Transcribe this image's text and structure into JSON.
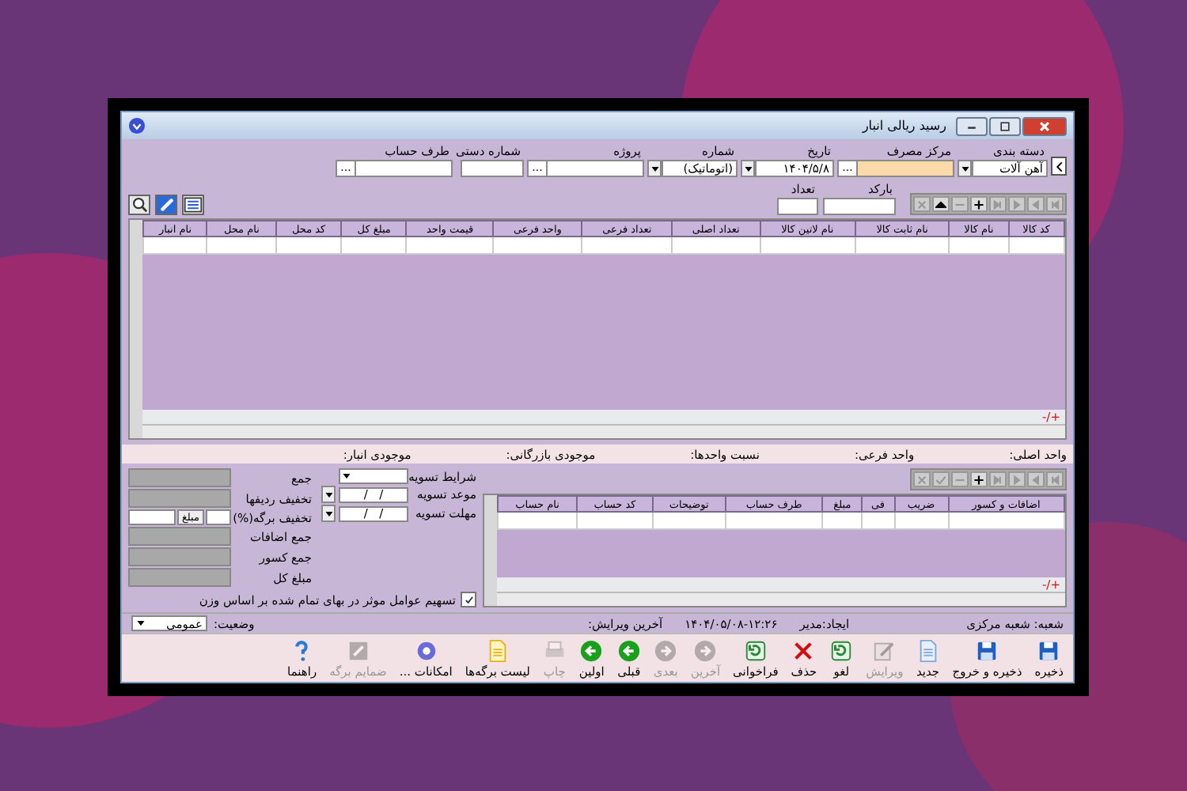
{
  "window": {
    "title": "رسید ریالی انبار"
  },
  "header_fields": [
    {
      "label": "دسته بندی",
      "kind": "dropdown",
      "value": "آهن آلات",
      "highlighted": false
    },
    {
      "label": "مرکز مصرف",
      "kind": "lookup",
      "lookup_button": "...",
      "highlighted": true
    },
    {
      "label": "تاریخ",
      "kind": "date",
      "value": "۱۴۰۴/۵/۸",
      "highlighted": false
    },
    {
      "label": "شماره",
      "kind": "dropdown",
      "value": "(اتوماتیک)",
      "highlighted": false
    },
    {
      "label": "پروژه",
      "kind": "lookup",
      "lookup_button": "...",
      "highlighted": false
    },
    {
      "label": "شماره دستی",
      "kind": "text",
      "highlighted": false
    },
    {
      "label": "طرف حساب",
      "kind": "lookup",
      "lookup_button": "...",
      "highlighted": false
    }
  ],
  "item_nav": [
    {
      "kind": "first",
      "disabled": true
    },
    {
      "kind": "prev",
      "disabled": true
    },
    {
      "kind": "next",
      "disabled": true
    },
    {
      "kind": "last",
      "disabled": true
    },
    {
      "kind": "add",
      "disabled": false
    },
    {
      "kind": "remove",
      "disabled": true
    },
    {
      "kind": "up",
      "disabled": false
    },
    {
      "kind": "cancel",
      "disabled": true
    }
  ],
  "barcode": {
    "label": "بارکد"
  },
  "quantity": {
    "label": "تعداد"
  },
  "items_table": {
    "columns": [
      "کد کالا",
      "نام کالا",
      "نام ثابت کالا",
      "نام لاتین کالا",
      "تعداد اصلی",
      "تعداد فرعی",
      "واحد فرعی",
      "قیمت واحد",
      "مبلغ کل",
      "کد محل",
      "نام محل",
      "نام انبار"
    ],
    "footer_mark": "-/+"
  },
  "info_strip": [
    "واحد اصلی:",
    "واحد فرعی:",
    "نسبت واحدها:",
    "موجودی بازرگانی:",
    "موجودی انبار:"
  ],
  "charges_nav": [
    {
      "kind": "first",
      "disabled": true
    },
    {
      "kind": "prev",
      "disabled": true
    },
    {
      "kind": "next",
      "disabled": true
    },
    {
      "kind": "last",
      "disabled": true
    },
    {
      "kind": "add",
      "disabled": false
    },
    {
      "kind": "remove",
      "disabled": true
    },
    {
      "kind": "confirm",
      "disabled": true
    },
    {
      "kind": "cancel",
      "disabled": true
    }
  ],
  "charges_table": {
    "columns": [
      "اضافات و کسور",
      "ضریب",
      "فی",
      "مبلغ",
      "طرف حساب",
      "توضیحات",
      "کد حساب",
      "نام حساب"
    ],
    "footer_mark": "-/+"
  },
  "settlement": [
    {
      "label": "شرایط تسویه",
      "kind": "dropdown"
    },
    {
      "label": "موعد تسویه",
      "kind": "date",
      "value": "/   /"
    },
    {
      "label": "مهلت تسویه",
      "kind": "date",
      "value": "/   /"
    }
  ],
  "totals": [
    {
      "label": "جمع"
    },
    {
      "label": "تخفیف ردیفها"
    },
    {
      "label": "تخفیف برگه(%)",
      "button": "مبلغ"
    },
    {
      "label": "جمع اضافات"
    },
    {
      "label": "جمع کسور"
    },
    {
      "label": "مبلغ کل"
    }
  ],
  "allocation_checkbox": {
    "label": "تسهیم عوامل موثر در بهای تمام شده بر اساس وزن",
    "checked": true
  },
  "status": {
    "branch": "شعبه: شعبه مرکزی",
    "created": "ایجاد:مدیر",
    "timestamp": "۱۴۰۴/۰۵/۰۸-۱۲:۲۶",
    "last_edit": "آخرین ویرایش:",
    "state_label": "وضعیت:",
    "state_value": "عمومی"
  },
  "toolbar": [
    {
      "label": "ذخیره",
      "kind": "save",
      "disabled": false
    },
    {
      "label": "ذخیره و خروج",
      "kind": "save",
      "disabled": false
    },
    {
      "label": "جدید",
      "kind": "new",
      "disabled": false
    },
    {
      "label": "ویرایش",
      "kind": "edit",
      "disabled": true
    },
    {
      "label": "لغو",
      "kind": "undo",
      "disabled": false
    },
    {
      "label": "حذف",
      "kind": "delete",
      "disabled": false
    },
    {
      "label": "فراخوانی",
      "kind": "recall",
      "disabled": false
    },
    {
      "label": "آخرین",
      "kind": "last",
      "disabled": true
    },
    {
      "label": "بعدی",
      "kind": "next",
      "disabled": true
    },
    {
      "label": "قبلی",
      "kind": "prev",
      "disabled": false
    },
    {
      "label": "اولین",
      "kind": "first",
      "disabled": false
    },
    {
      "label": "چاپ",
      "kind": "print",
      "disabled": true
    },
    {
      "label": "لیست برگه‌ها",
      "kind": "list",
      "disabled": false
    },
    {
      "label": "امکانات ...",
      "kind": "options",
      "disabled": false
    },
    {
      "label": "ضمایم برگه",
      "kind": "attach",
      "disabled": true
    },
    {
      "label": "راهنما",
      "kind": "help",
      "disabled": false
    }
  ]
}
